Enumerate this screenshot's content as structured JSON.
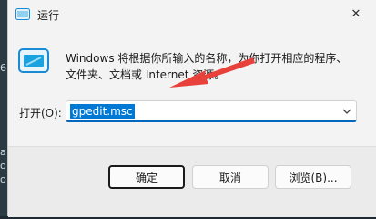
{
  "window": {
    "title": "运行",
    "close_glyph": "✕"
  },
  "background": {
    "marks": [
      "6",
      "a",
      "o",
      "o"
    ]
  },
  "description": {
    "line1": "Windows 将根据你所输入的名称，为你打开相应的程序、",
    "line2": "文件夹、文档或 Internet 资源。"
  },
  "open": {
    "label": "打开(O):",
    "value": "gpedit.msc"
  },
  "buttons": {
    "ok": "确定",
    "cancel": "取消",
    "browse": "浏览(B)..."
  },
  "colors": {
    "accent": "#0078d4",
    "annotation_arrow": "#e8403a"
  },
  "icons": [
    "run-app-icon",
    "close-icon",
    "run-icon",
    "chevron-down-icon",
    "annotation-arrow"
  ]
}
